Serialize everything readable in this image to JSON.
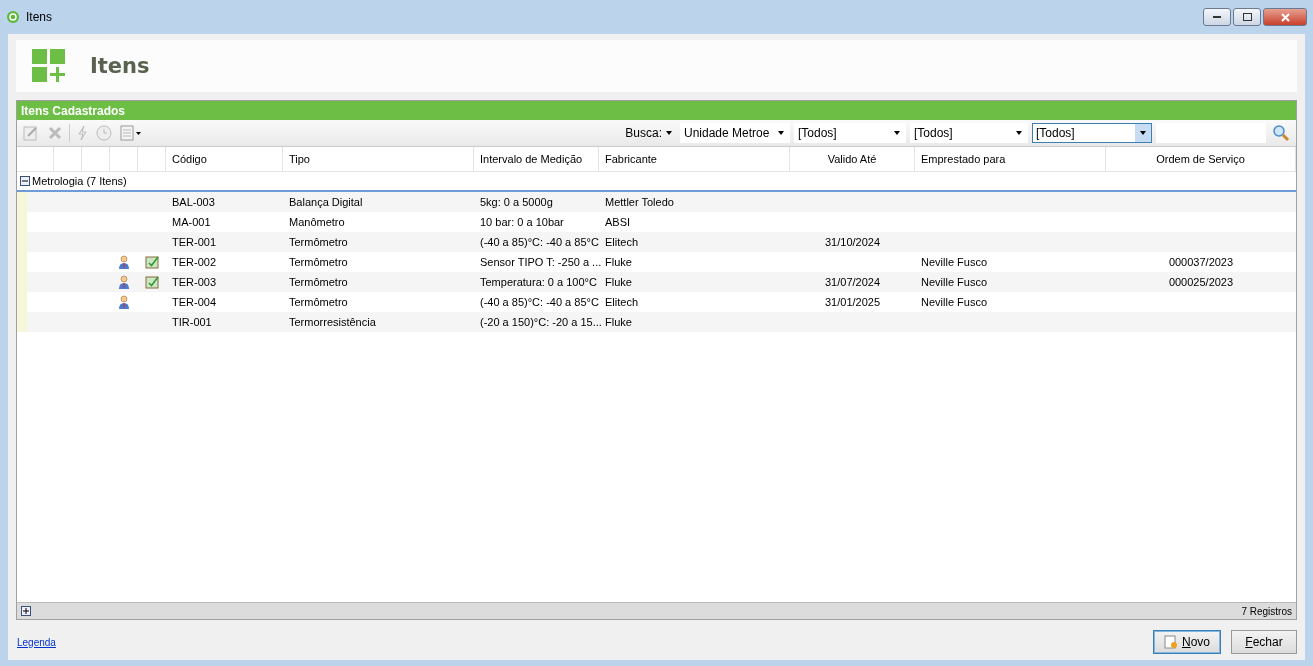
{
  "window": {
    "title": "Itens"
  },
  "header": {
    "title": "Itens"
  },
  "panel": {
    "title": "Itens Cadastrados"
  },
  "toolbar": {
    "search_label": "Busca:",
    "filters": [
      {
        "value": "Unidade Metroe",
        "selected": false
      },
      {
        "value": "[Todos]",
        "selected": false
      },
      {
        "value": "[Todos]",
        "selected": false
      },
      {
        "value": "[Todos]",
        "selected": true
      }
    ]
  },
  "table": {
    "columns": [
      "Código",
      "Tipo",
      "Intervalo de Medição",
      "Fabricante",
      "Valido Até",
      "Emprestado para",
      "Ordem de Serviço"
    ],
    "group": {
      "label": "Metrologia (7 Itens)",
      "expanded": true
    },
    "rows": [
      {
        "loaned": false,
        "service_order": false,
        "cells": [
          "BAL-003",
          "Balança Digital",
          "5kg: 0 a 5000g",
          "Mettler Toledo",
          "",
          "",
          ""
        ]
      },
      {
        "loaned": false,
        "service_order": false,
        "cells": [
          "MA-001",
          "Manômetro",
          "10 bar: 0 a 10bar",
          "ABSI",
          "",
          "",
          ""
        ]
      },
      {
        "loaned": false,
        "service_order": false,
        "cells": [
          "TER-001",
          "Termômetro",
          "(-40 a 85)°C: -40 a 85°C",
          "Elitech",
          "31/10/2024",
          "",
          ""
        ]
      },
      {
        "loaned": true,
        "service_order": true,
        "cells": [
          "TER-002",
          "Termômetro",
          "Sensor TIPO T: -250 a ...",
          "Fluke",
          "",
          "Neville Fusco",
          "000037/2023"
        ]
      },
      {
        "loaned": true,
        "service_order": true,
        "cells": [
          "TER-003",
          "Termômetro",
          "Temperatura: 0 a 100°C",
          "Fluke",
          "31/07/2024",
          "Neville Fusco",
          "000025/2023"
        ]
      },
      {
        "loaned": true,
        "service_order": false,
        "cells": [
          "TER-004",
          "Termômetro",
          "(-40 a 85)°C: -40 a 85°C",
          "Elitech",
          "31/01/2025",
          "Neville Fusco",
          ""
        ]
      },
      {
        "loaned": false,
        "service_order": false,
        "cells": [
          "TIR-001",
          "Termorresistência",
          "(-20 a 150)°C: -20 a 15...",
          "Fluke",
          "",
          "",
          ""
        ]
      }
    ]
  },
  "footer": {
    "count": "7 Registros"
  },
  "legend_link": "Legenda",
  "buttons": [
    {
      "label": "Novo",
      "default": true
    },
    {
      "label": "Fechar",
      "default": false
    }
  ]
}
